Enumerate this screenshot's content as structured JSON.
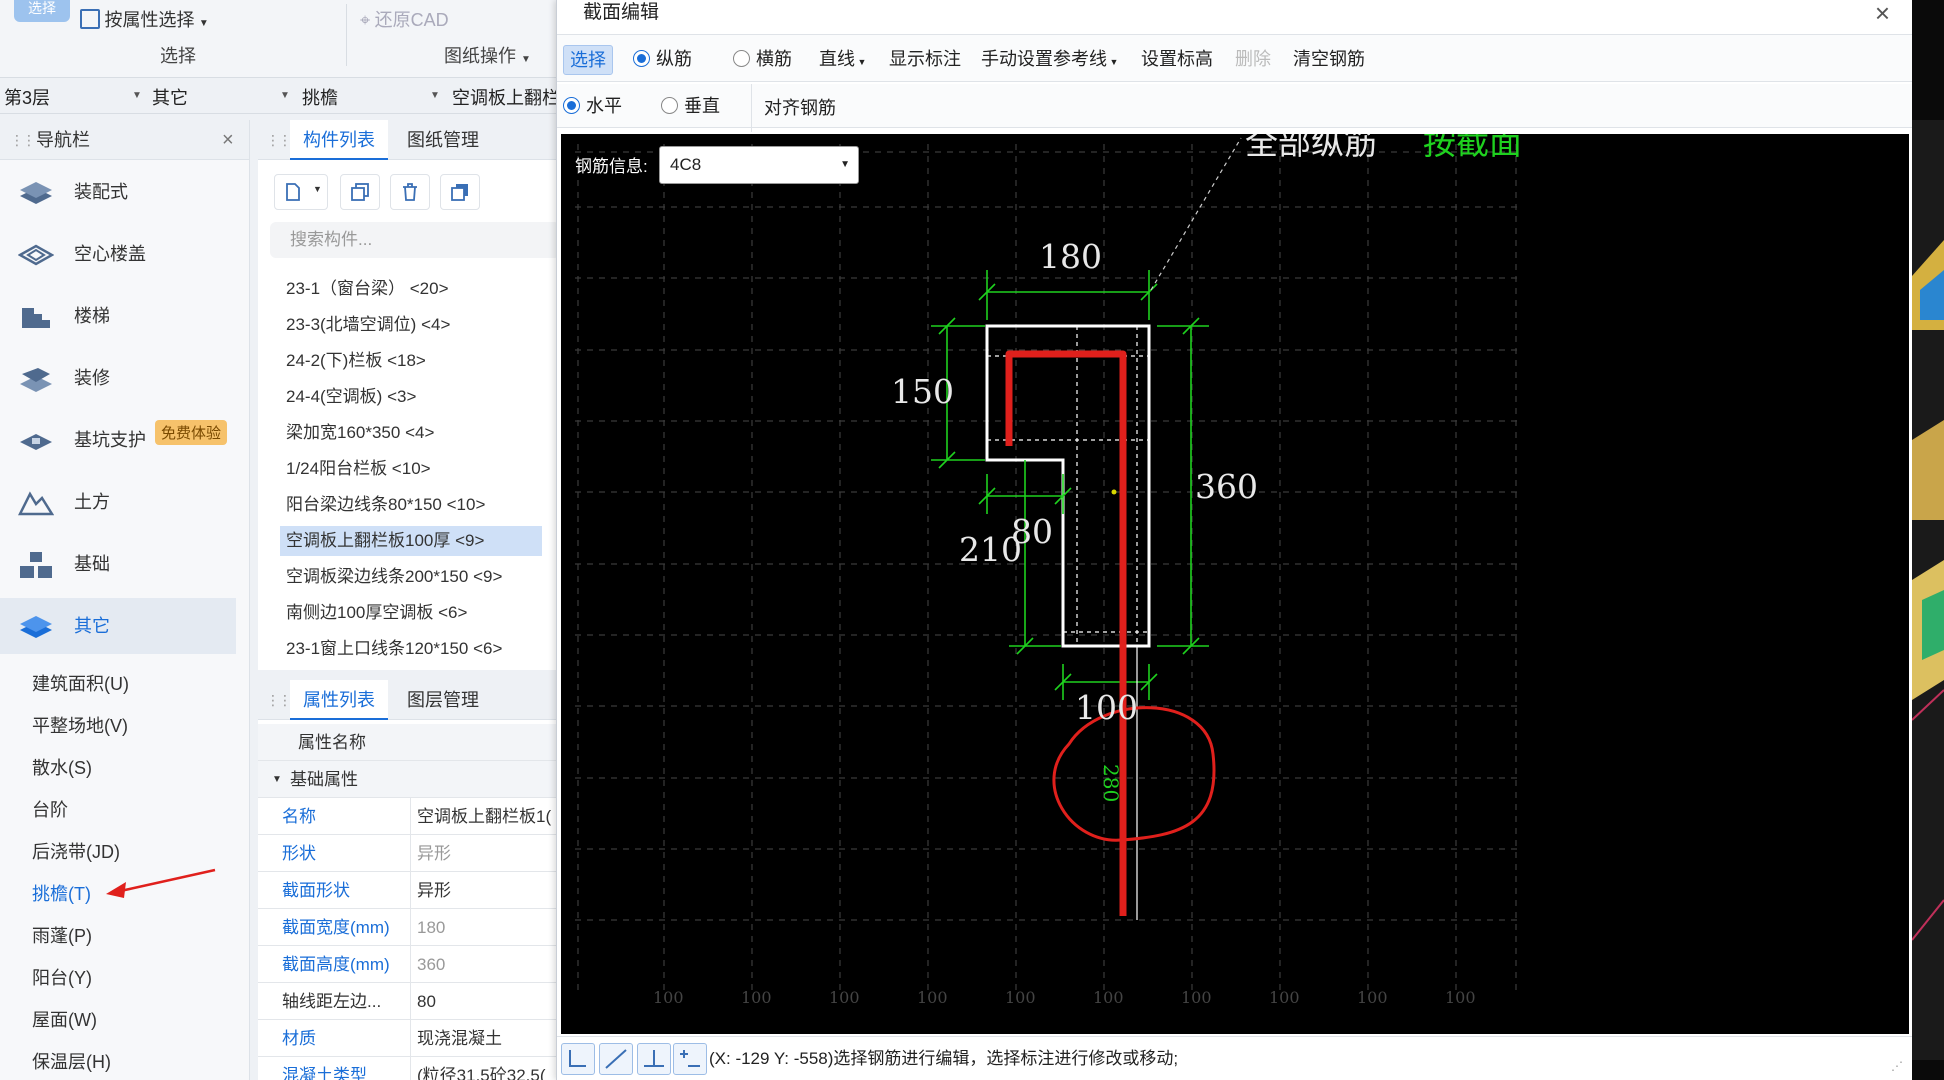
{
  "ribbon": {
    "select_tab": "选择",
    "attr_select": "按属性选择",
    "restore_cad": "还原CAD",
    "group_select": "选择",
    "group_drawing": "图纸操作"
  },
  "filters": {
    "floor": "第3层",
    "category": "其它",
    "type": "挑檐",
    "component": "空调板上翻栏"
  },
  "nav": {
    "title": "导航栏",
    "items": [
      {
        "label": "装配式",
        "icon": "prefab-icon"
      },
      {
        "label": "空心楼盖",
        "icon": "hollow-floor-icon"
      },
      {
        "label": "楼梯",
        "icon": "stairs-icon"
      },
      {
        "label": "装修",
        "icon": "decoration-icon"
      },
      {
        "label": "基坑支护",
        "icon": "pit-support-icon"
      },
      {
        "label": "土方",
        "icon": "earthwork-icon"
      },
      {
        "label": "基础",
        "icon": "foundation-icon"
      },
      {
        "label": "其它",
        "icon": "other-layers-icon"
      }
    ],
    "badge": "免费体验",
    "sub_items": [
      "建筑面积(U)",
      "平整场地(V)",
      "散水(S)",
      "台阶",
      "后浇带(JD)",
      "挑檐(T)",
      "雨蓬(P)",
      "阳台(Y)",
      "屋面(W)",
      "保温层(H)"
    ]
  },
  "components": {
    "tabs": [
      "构件列表",
      "图纸管理"
    ],
    "search_placeholder": "搜索构件...",
    "rows": [
      "23-1（窗台梁） <20>",
      "23-3(北墙空调位)  <4>",
      "24-2(下)栏板 <18>",
      "24-4(空调板)  <3>",
      "梁加宽160*350 <4>",
      "1/24阳台栏板 <10>",
      "阳台梁边线条80*150 <10>",
      "空调板上翻栏板100厚 <9>",
      "空调板梁边线条200*150 <9>",
      "南侧边100厚空调板 <6>",
      "23-1窗上口线条120*150 <6>"
    ]
  },
  "properties": {
    "tabs": [
      "属性列表",
      "图层管理"
    ],
    "header": "属性名称",
    "group": "基础属性",
    "rows": [
      {
        "k": "名称",
        "v": "空调板上翻栏板1("
      },
      {
        "k": "形状",
        "v": "异形"
      },
      {
        "k": "截面形状",
        "v": "异形"
      },
      {
        "k": "截面宽度(mm)",
        "v": "180"
      },
      {
        "k": "截面高度(mm)",
        "v": "360"
      },
      {
        "k": "轴线距左边...",
        "v": "80"
      },
      {
        "k": "材质",
        "v": "现浇混凝土"
      },
      {
        "k": "混凝土类型",
        "v": "(粒径31.5砼32.5("
      }
    ]
  },
  "dialog": {
    "title": "截面编辑",
    "toolbar1": {
      "select": "选择",
      "longitudinal": "纵筋",
      "transverse": "横筋",
      "line": "直线",
      "show_label": "显示标注",
      "manual_ref": "手动设置参考线",
      "set_elev": "设置标高",
      "delete": "删除",
      "clear": "清空钢筋"
    },
    "toolbar2": {
      "horizontal": "水平",
      "vertical": "垂直",
      "align": "对齐钢筋"
    },
    "rebar_info_label": "钢筋信息:",
    "rebar_info_value": "4C8",
    "cad_labels": {
      "all_long": "全部纵筋",
      "by_section": "按截面",
      "d180": "180",
      "d150": "150",
      "d360": "360",
      "d80": "80",
      "d210": "210",
      "d100": "100",
      "d280": "280"
    },
    "grid_ticks": [
      "100",
      "100",
      "100",
      "100",
      "100",
      "100",
      "100",
      "100",
      "100",
      "100"
    ],
    "status": "(X: -129 Y: -558)选择钢筋进行编辑，选择标注进行修改或移动;"
  },
  "colors": {
    "accent": "#1a6ed8",
    "rebar": "#e0201c",
    "dim": "#1fd11f",
    "annotation": "#e0201c"
  }
}
